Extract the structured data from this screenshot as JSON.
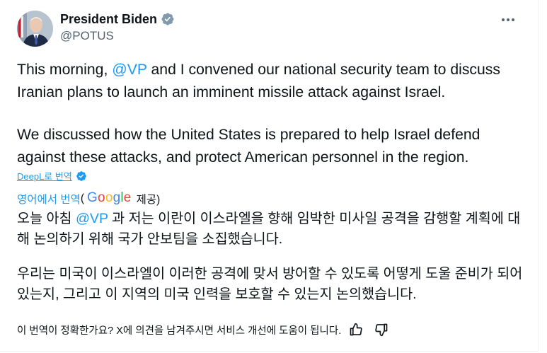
{
  "author": {
    "display_name": "President Biden",
    "handle": "@POTUS",
    "verified_icon": "verified-badge-icon",
    "verified_color": "#829aab"
  },
  "more_icon": "more-horizontal-icon",
  "tweet": {
    "p1": {
      "before": "This morning, ",
      "mention": "@VP",
      "after": " and I convened our national security team to discuss Iranian plans to launch an imminent missile attack against Israel."
    },
    "p2": "We discussed how the United States is prepared to help Israel defend against these attacks, and protect American personnel in the region."
  },
  "deepl": {
    "label": "DeepL로 번역",
    "icon": "deepl-badge-icon"
  },
  "translation": {
    "prefix_link": "영어에서 번역",
    "paren_open": "(",
    "provider_logo": "Google",
    "suffix": "제공)",
    "p1": {
      "before": "오늘 아침 ",
      "mention": "@VP",
      "after": " 과 저는 이란이 이스라엘을 향해 임박한 미사일 공격을 감행할 계획에 대해 논의하기 위해 국가 안보팀을 소집했습니다."
    },
    "p2": "우리는 미국이 이스라엘이 이러한 공격에 맞서 방어할 수 있도록 어떻게 도울 준비가 되어 있는지, 그리고 이 지역의 미국 인력을 보호할 수 있는지 논의했습니다."
  },
  "feedback": {
    "text": "이 번역이 정확한가요? X에 의견을 남겨주시면 서비스 개선에 도움이 됩니다.",
    "thumbs_up_icon": "thumbs-up-icon",
    "thumbs_down_icon": "thumbs-down-icon"
  },
  "colors": {
    "accent": "#1d9bf0",
    "text": "#0f1419",
    "secondary": "#536471"
  }
}
